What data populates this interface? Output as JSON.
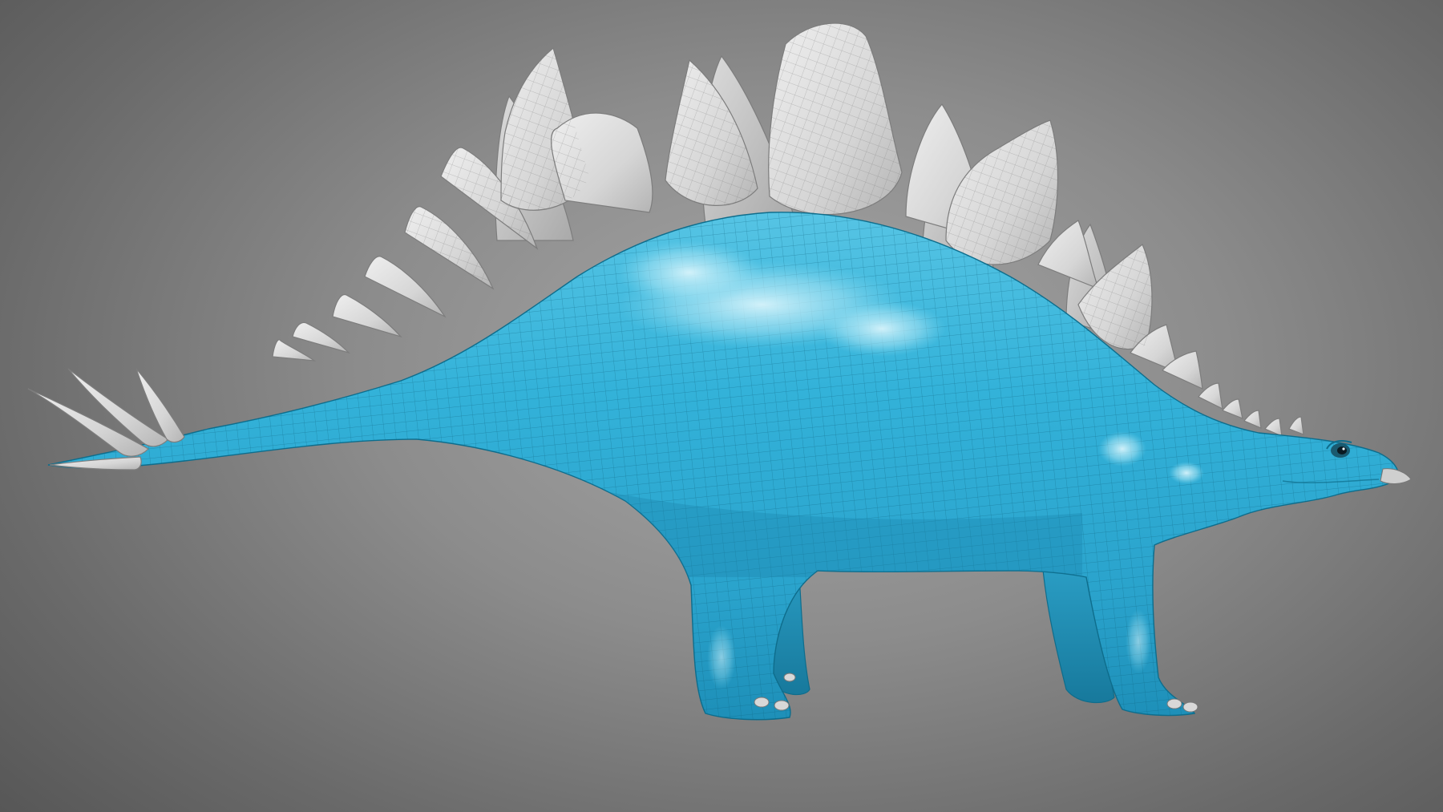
{
  "scene": {
    "subject": "stegosaurus-model",
    "colors": {
      "background_center": "#a6a6a6",
      "background_edge": "#555555",
      "body": "#2aa9d1",
      "body_highlight": "#7fd8ef",
      "body_shadow": "#1787ad",
      "plates": "#d8d8d8",
      "wireframe": "#0b5f7a",
      "plate_wireframe": "#6e6e6e"
    }
  }
}
